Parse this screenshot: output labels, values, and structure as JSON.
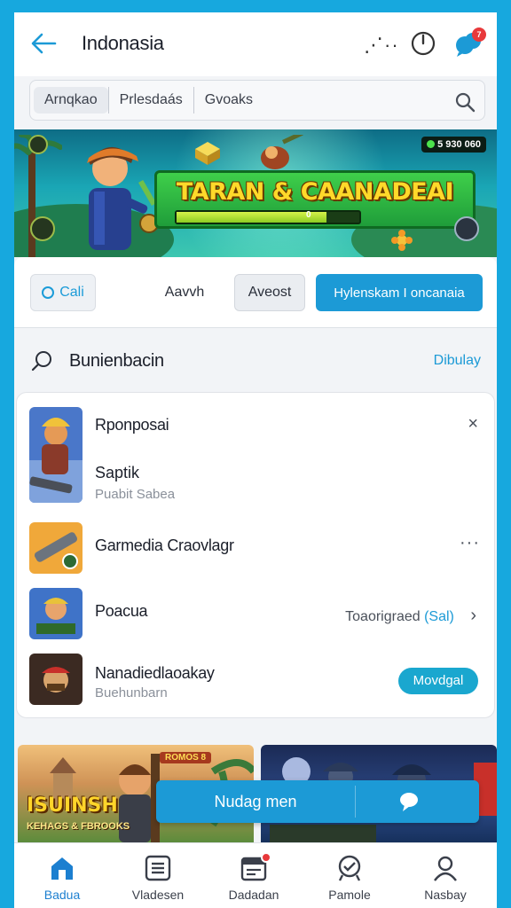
{
  "header": {
    "title": "Indonasia",
    "more_label": "⋰··",
    "notification_count": "7"
  },
  "filters": {
    "segments": [
      "Arnqkao",
      "Prlesdaás",
      "Gvoaks"
    ]
  },
  "banner": {
    "title": "TARAN & CAANADEAI",
    "coins": "5 930 060",
    "progress_label": "0",
    "progress_fraction": 0.82
  },
  "tabs": {
    "cali": "Cali",
    "aavvh": "Aavvh",
    "aveost": "Aveost",
    "primary": "Hylenskam I oncanaia"
  },
  "section": {
    "title": "Bunienbacin",
    "link": "Dibulay"
  },
  "list": [
    {
      "name": "Rponposai",
      "sub_title": "Saptik",
      "sub": "Puabit Sabea",
      "trailing": "×"
    },
    {
      "name": "Garmedia Craovlagr",
      "trailing": "···"
    },
    {
      "name": "Poacua",
      "trailing_text": "Toaorigraed",
      "trailing_accent": "(Sal)",
      "chevron": "›"
    },
    {
      "name": "Nanadiedlaoakay",
      "sub": "Buehunbarn",
      "button": "Movdgal"
    }
  ],
  "promos": {
    "left_tag": "ROMOS 8",
    "left_title": "ISUINSH",
    "left_sub": "KEHAGS & FBROOKS"
  },
  "float_bar": {
    "label": "Nudag men"
  },
  "nav": [
    {
      "label": "Badua",
      "icon": "home-icon"
    },
    {
      "label": "Vladesen",
      "icon": "list-icon"
    },
    {
      "label": "Dadadan",
      "icon": "calendar-icon"
    },
    {
      "label": "Pamole",
      "icon": "badge-icon"
    },
    {
      "label": "Nasbay",
      "icon": "user-icon"
    }
  ],
  "colors": {
    "accent": "#1c9ad6",
    "frame": "#17a8de",
    "badge": "#e8393b"
  }
}
